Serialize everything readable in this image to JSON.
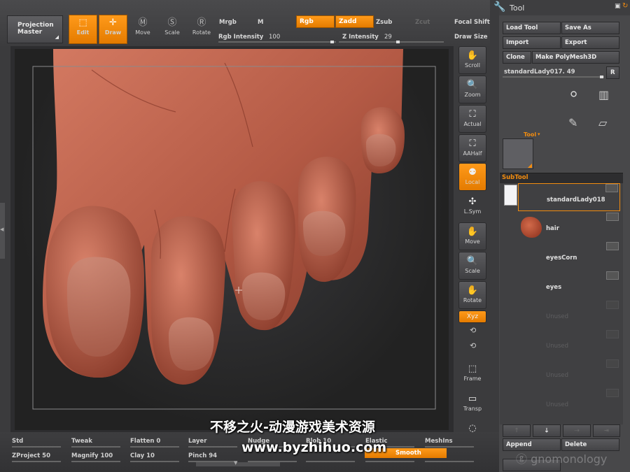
{
  "top": {
    "projection_master": [
      "Projection",
      "Master"
    ],
    "edit_label": "Edit",
    "draw_label": "Draw",
    "move_label": "Move",
    "scale_label": "Scale",
    "rotate_label": "Rotate",
    "mrgb_label": "Mrgb",
    "m_label": "M",
    "rgb_label": "Rgb",
    "zadd_label": "Zadd",
    "zsub_label": "Zsub",
    "zcut_label": "Zcut",
    "focal_label": "Focal Shift",
    "rgb_intensity_label": "Rgb Intensity",
    "rgb_intensity_value": "100",
    "z_intensity_label": "Z Intensity",
    "z_intensity_value": "29",
    "draw_size_label": "Draw Size"
  },
  "shelf": [
    {
      "label": "Scroll",
      "icon": "hand-scroll-icon",
      "glyph": "✋"
    },
    {
      "label": "Zoom",
      "icon": "magnifier-icon",
      "glyph": "🔍"
    },
    {
      "label": "Actual",
      "icon": "actual-size-icon",
      "glyph": "⛶"
    },
    {
      "label": "AAHalf",
      "icon": "half-size-icon",
      "glyph": "⛶"
    },
    {
      "label": "Local",
      "icon": "local-transform-icon",
      "glyph": "⚉"
    },
    {
      "label": "L.Sym",
      "icon": "local-symmetry-icon",
      "glyph": "✣"
    },
    {
      "label": "Move",
      "icon": "move-hand-icon",
      "glyph": "✋"
    },
    {
      "label": "Scale",
      "icon": "scale-magnifier-icon",
      "glyph": "🔍"
    },
    {
      "label": "Rotate",
      "icon": "rotate-hand-icon",
      "glyph": "✋"
    },
    {
      "label": "Xyz",
      "icon": "xyz-axis-icon",
      "glyph": "⟲"
    },
    {
      "label": "Frame",
      "icon": "frame-cube-icon",
      "glyph": "⬚"
    },
    {
      "label": "Transp",
      "icon": "transparency-icon",
      "glyph": "▭"
    },
    {
      "label": "Lasso",
      "icon": "lasso-icon",
      "glyph": "◌"
    }
  ],
  "tool": {
    "title": "Tool",
    "load_tool": "Load Tool",
    "save_as": "Save As",
    "import": "Import",
    "export": "Export",
    "clone": "Clone",
    "make_polymesh": "Make PolyMesh3D",
    "current_tool": "standardLady017. 49",
    "r_label": "R",
    "tool_dropdown": "Tool",
    "subtool_title": "SubTool",
    "subtools": [
      "standardLady018",
      "hair",
      "eyesCorn",
      "eyes",
      "Unused",
      "Unused",
      "Unused",
      "Unused"
    ],
    "append": "Append",
    "delete": "Delete"
  },
  "bottom": {
    "row1": [
      "Std",
      "Tweak",
      "Flatten 0",
      "Layer",
      "Nudge",
      "Blob 10",
      "Elastic",
      "MeshIns"
    ],
    "row2": [
      "ZProject 50",
      "Magnify 100",
      "Clay 10",
      "Pinch 94",
      "",
      "",
      "Smooth",
      ""
    ]
  },
  "watermark": {
    "cn": "不移之火-动漫游戏美术资源",
    "url": "www.byzhihuo.com",
    "logo": "gnomonology"
  },
  "colors": {
    "accent": "#f28c0f",
    "skin": "#b85c4a",
    "panel": "#48484a"
  }
}
